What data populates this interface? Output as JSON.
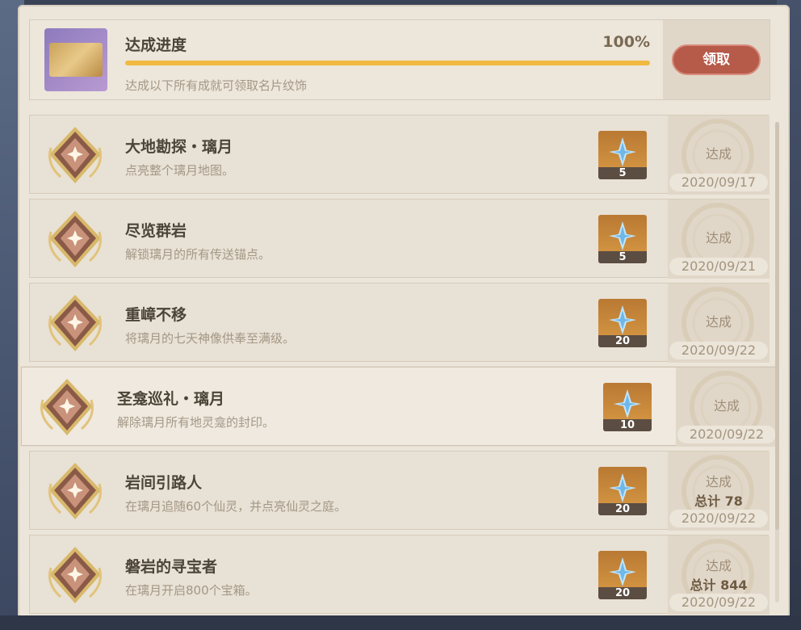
{
  "header": {
    "title": "达成进度",
    "percent": "100%",
    "progress": 1.0,
    "subtitle": "达成以下所有成就可领取名片纹饰",
    "claim_label": "领取"
  },
  "achievements": [
    {
      "title": "大地勘探・璃月",
      "desc": "点亮整个璃月地图。",
      "reward": "5",
      "status": "达成",
      "total": "",
      "date": "2020/09/17"
    },
    {
      "title": "尽览群岩",
      "desc": "解锁璃月的所有传送锚点。",
      "reward": "5",
      "status": "达成",
      "total": "",
      "date": "2020/09/21"
    },
    {
      "title": "重嶂不移",
      "desc": "将璃月的七天神像供奉至满级。",
      "reward": "20",
      "status": "达成",
      "total": "",
      "date": "2020/09/22"
    },
    {
      "title": "圣龛巡礼・璃月",
      "desc": "解除璃月所有地灵龛的封印。",
      "reward": "10",
      "status": "达成",
      "total": "",
      "date": "2020/09/22"
    },
    {
      "title": "岩间引路人",
      "desc": "在璃月追随60个仙灵，并点亮仙灵之庭。",
      "reward": "20",
      "status": "达成",
      "total": "总计 78",
      "date": "2020/09/22"
    },
    {
      "title": "磐岩的寻宝者",
      "desc": "在璃月开启800个宝箱。",
      "reward": "20",
      "status": "达成",
      "total": "总计 844",
      "date": "2020/09/22"
    }
  ],
  "colors": {
    "accent": "#f2b940",
    "claim": "#b65a4a",
    "title": "#4b4437"
  }
}
